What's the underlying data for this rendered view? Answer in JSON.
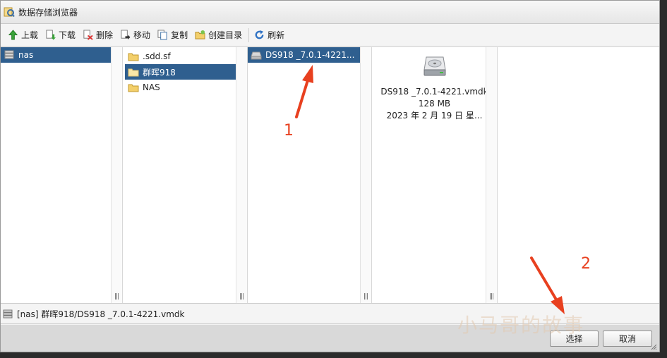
{
  "window": {
    "title": "数据存储浏览器"
  },
  "toolbar": {
    "upload": "上载",
    "download": "下载",
    "delete": "删除",
    "move": "移动",
    "copy": "复制",
    "mkdir": "创建目录",
    "refresh": "刷新"
  },
  "columns": {
    "datastores": [
      {
        "label": "nas",
        "selected": true
      }
    ],
    "folders": [
      {
        "label": ".sdd.sf",
        "selected": false
      },
      {
        "label": "群晖918",
        "selected": true
      },
      {
        "label": "NAS",
        "selected": false
      }
    ],
    "files": [
      {
        "label": "DS918 _7.0.1-4221...",
        "selected": true
      }
    ],
    "preview": {
      "name": "DS918 _7.0.1-4221.vmdk",
      "size": "128 MB",
      "date": "2023 年 2 月 19 日 星..."
    }
  },
  "status": {
    "path": "[nas] 群晖918/DS918 _7.0.1-4221.vmdk"
  },
  "footer": {
    "select": "选择",
    "cancel": "取消"
  },
  "annotations": {
    "label1": "1",
    "label2": "2",
    "color": "#e8401f"
  },
  "watermark": "小马哥的故事",
  "colors": {
    "selection": "#2f5f8f"
  }
}
